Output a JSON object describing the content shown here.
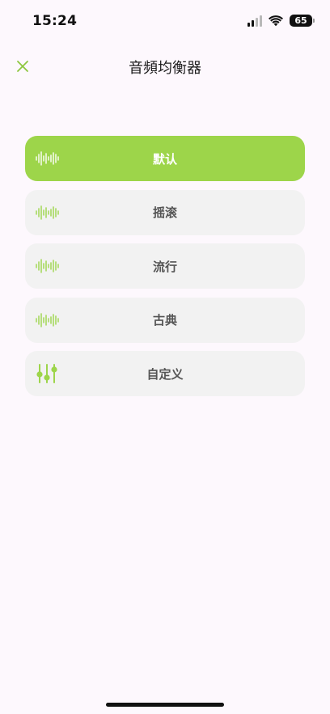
{
  "status_bar": {
    "time": "15:24",
    "battery": "65"
  },
  "nav": {
    "title": "音頻均衡器",
    "close_icon": "close-icon"
  },
  "presets": [
    {
      "label": "默认",
      "icon": "waveform-icon",
      "selected": true
    },
    {
      "label": "摇滚",
      "icon": "waveform-icon",
      "selected": false
    },
    {
      "label": "流行",
      "icon": "waveform-icon",
      "selected": false
    },
    {
      "label": "古典",
      "icon": "waveform-icon",
      "selected": false
    },
    {
      "label": "自定义",
      "icon": "sliders-icon",
      "selected": false
    }
  ],
  "colors": {
    "accent": "#9dd54a",
    "item_background": "#f2f2f2",
    "page_background": "#fdf8fd"
  }
}
